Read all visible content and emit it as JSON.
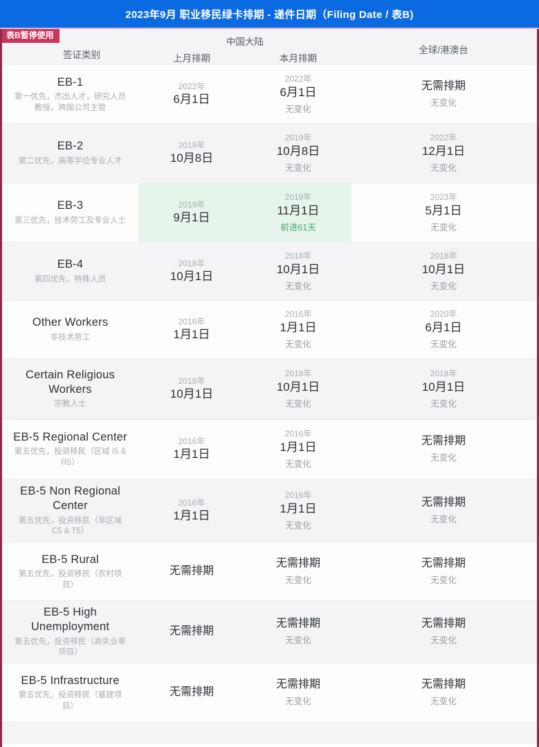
{
  "title": "2023年9月 职业移民绿卡排期 - 递件日期（Filing Date / 表B)",
  "badge": "表B暂停使用",
  "header": {
    "category": "签证类别",
    "china_group": "中国大陆",
    "prev_month": "上月排期",
    "cur_month": "本月排期",
    "worldwide": "全球/港澳台"
  },
  "colors": {
    "title_bar": "#0a6ae1",
    "badge_bg": "#c8365c",
    "frame_border": "#8e2b4c",
    "advance_green": "#3da871",
    "highlight_bg": "#e7f4ec",
    "alt_row": "#f4f4f6"
  },
  "rows": [
    {
      "name": "EB-1",
      "desc": "第一优先，杰出人才，研究人员\n教授，跨国公司主管",
      "prev": {
        "year": "2022年",
        "date": "6月1日",
        "note": ""
      },
      "cur": {
        "year": "2022年",
        "date": "6月1日",
        "note": "无变化"
      },
      "ww": {
        "year": "",
        "date": "无需排期",
        "note": "无变化"
      },
      "alt": false,
      "highlight": false
    },
    {
      "name": "EB-2",
      "desc": "第二优先，高等学位专业人才",
      "prev": {
        "year": "2019年",
        "date": "10月8日",
        "note": ""
      },
      "cur": {
        "year": "2019年",
        "date": "10月8日",
        "note": "无变化"
      },
      "ww": {
        "year": "2022年",
        "date": "12月1日",
        "note": "无变化"
      },
      "alt": true,
      "highlight": false
    },
    {
      "name": "EB-3",
      "desc": "第三优先，技术劳工及专业人士",
      "prev": {
        "year": "2019年",
        "date": "9月1日",
        "note": ""
      },
      "cur": {
        "year": "2019年",
        "date": "11月1日",
        "note": "前进61天"
      },
      "ww": {
        "year": "2023年",
        "date": "5月1日",
        "note": "无变化"
      },
      "alt": false,
      "highlight": true
    },
    {
      "name": "EB-4",
      "desc": "第四优先，特殊人员",
      "prev": {
        "year": "2018年",
        "date": "10月1日",
        "note": ""
      },
      "cur": {
        "year": "2018年",
        "date": "10月1日",
        "note": "无变化"
      },
      "ww": {
        "year": "2018年",
        "date": "10月1日",
        "note": "无变化"
      },
      "alt": true,
      "highlight": false
    },
    {
      "name": "Other Workers",
      "desc": "非技术劳工",
      "prev": {
        "year": "2016年",
        "date": "1月1日",
        "note": ""
      },
      "cur": {
        "year": "2016年",
        "date": "1月1日",
        "note": "无变化"
      },
      "ww": {
        "year": "2020年",
        "date": "6月1日",
        "note": "无变化"
      },
      "alt": false,
      "highlight": false
    },
    {
      "name": "Certain Religious Workers",
      "desc": "宗教人士",
      "prev": {
        "year": "2018年",
        "date": "10月1日",
        "note": ""
      },
      "cur": {
        "year": "2018年",
        "date": "10月1日",
        "note": "无变化"
      },
      "ww": {
        "year": "2018年",
        "date": "10月1日",
        "note": "无变化"
      },
      "alt": true,
      "highlight": false
    },
    {
      "name": "EB-5 Regional Center",
      "desc": "第五优先，投资移民（区域 I5 & R5）",
      "prev": {
        "year": "2016年",
        "date": "1月1日",
        "note": ""
      },
      "cur": {
        "year": "2016年",
        "date": "1月1日",
        "note": "无变化"
      },
      "ww": {
        "year": "",
        "date": "无需排期",
        "note": "无变化"
      },
      "alt": false,
      "highlight": false
    },
    {
      "name": "EB-5 Non Regional Center",
      "desc": "第五优先，投资移民（非区域 C5 & T5）",
      "prev": {
        "year": "2016年",
        "date": "1月1日",
        "note": ""
      },
      "cur": {
        "year": "2016年",
        "date": "1月1日",
        "note": "无变化"
      },
      "ww": {
        "year": "",
        "date": "无需排期",
        "note": "无变化"
      },
      "alt": true,
      "highlight": false
    },
    {
      "name": "EB-5 Rural",
      "desc": "第五优先，投资移民（农村项目）",
      "prev": {
        "year": "",
        "date": "无需排期",
        "note": ""
      },
      "cur": {
        "year": "",
        "date": "无需排期",
        "note": "无变化"
      },
      "ww": {
        "year": "",
        "date": "无需排期",
        "note": "无变化"
      },
      "alt": false,
      "highlight": false
    },
    {
      "name": "EB-5 High Unemployment",
      "desc": "第五优先，投资移民（高失业率项目）",
      "prev": {
        "year": "",
        "date": "无需排期",
        "note": ""
      },
      "cur": {
        "year": "",
        "date": "无需排期",
        "note": "无变化"
      },
      "ww": {
        "year": "",
        "date": "无需排期",
        "note": "无变化"
      },
      "alt": true,
      "highlight": false
    },
    {
      "name": "EB-5 Infrastructure",
      "desc": "第五优先，投资移民（基建项目）",
      "prev": {
        "year": "",
        "date": "无需排期",
        "note": ""
      },
      "cur": {
        "year": "",
        "date": "无需排期",
        "note": "无变化"
      },
      "ww": {
        "year": "",
        "date": "无需排期",
        "note": "无变化"
      },
      "alt": false,
      "highlight": false
    }
  ]
}
